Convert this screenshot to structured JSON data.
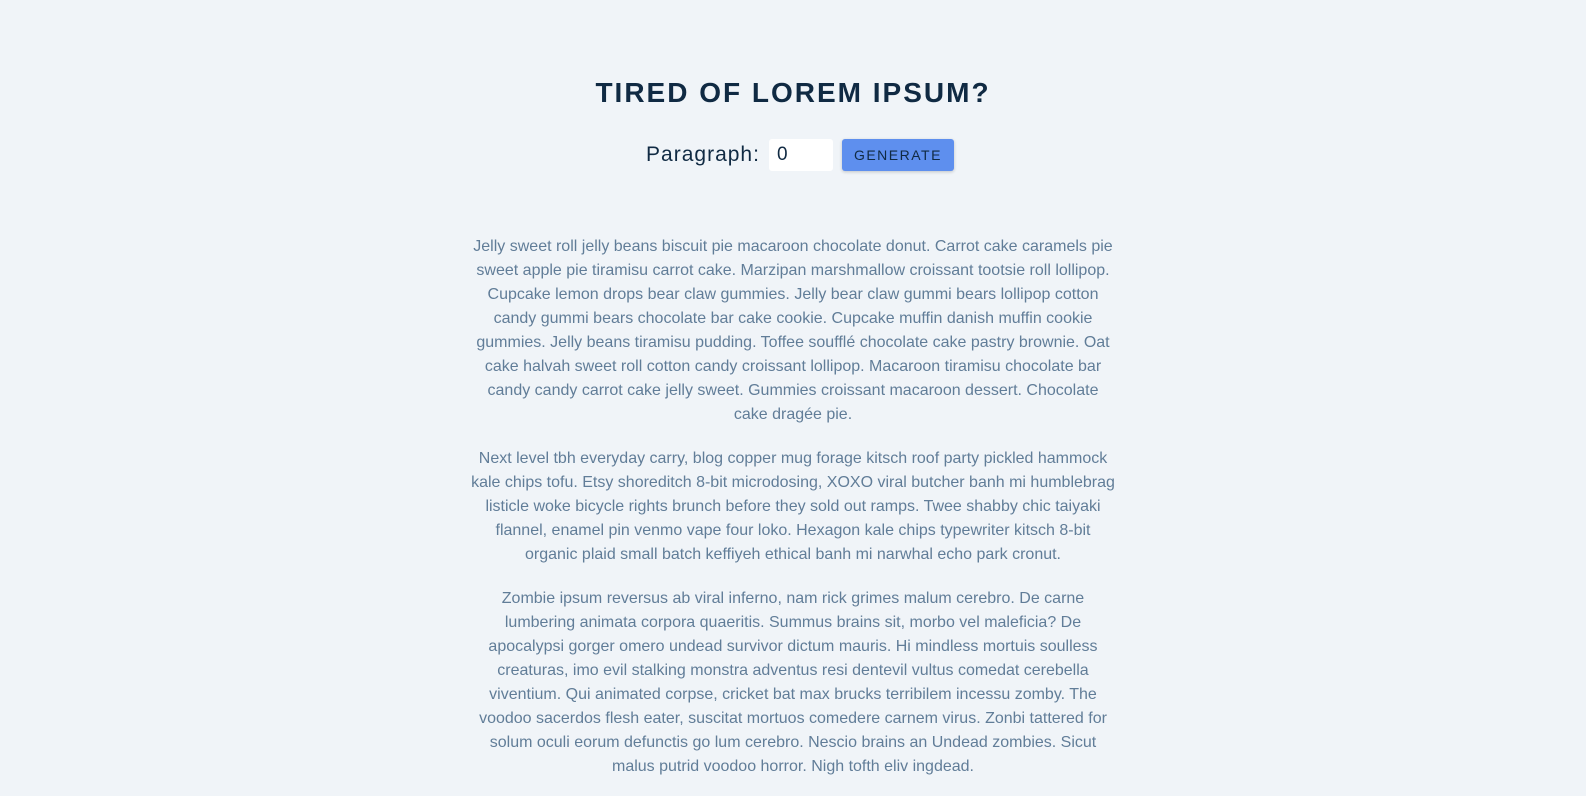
{
  "header": {
    "title": "TIRED OF LOREM IPSUM?"
  },
  "form": {
    "label": "Paragraph:",
    "input_value": "0",
    "button_label": "GENERATE"
  },
  "content": {
    "paragraphs": [
      "Jelly sweet roll jelly beans biscuit pie macaroon chocolate donut. Carrot cake caramels pie sweet apple pie tiramisu carrot cake. Marzipan marshmallow croissant tootsie roll lollipop. Cupcake lemon drops bear claw gummies. Jelly bear claw gummi bears lollipop cotton candy gummi bears chocolate bar cake cookie. Cupcake muffin danish muffin cookie gummies. Jelly beans tiramisu pudding. Toffee soufflé chocolate cake pastry brownie. Oat cake halvah sweet roll cotton candy croissant lollipop. Macaroon tiramisu chocolate bar candy candy carrot cake jelly sweet. Gummies croissant macaroon dessert. Chocolate cake dragée pie.",
      "Next level tbh everyday carry, blog copper mug forage kitsch roof party pickled hammock kale chips tofu. Etsy shoreditch 8-bit microdosing, XOXO viral butcher banh mi humblebrag listicle woke bicycle rights brunch before they sold out ramps. Twee shabby chic taiyaki flannel, enamel pin venmo vape four loko. Hexagon kale chips typewriter kitsch 8-bit organic plaid small batch keffiyeh ethical banh mi narwhal echo park cronut.",
      "Zombie ipsum reversus ab viral inferno, nam rick grimes malum cerebro. De carne lumbering animata corpora quaeritis. Summus brains sit, morbo vel maleficia? De apocalypsi gorger omero undead survivor dictum mauris. Hi mindless mortuis soulless creaturas, imo evil stalking monstra adventus resi dentevil vultus comedat cerebella viventium. Qui animated corpse, cricket bat max brucks terribilem incessu zomby. The voodoo sacerdos flesh eater, suscitat mortuos comedere carnem virus. Zonbi tattered for solum oculi eorum defunctis go lum cerebro. Nescio brains an Undead zombies. Sicut malus putrid voodoo horror. Nigh tofth eliv ingdead."
    ]
  }
}
